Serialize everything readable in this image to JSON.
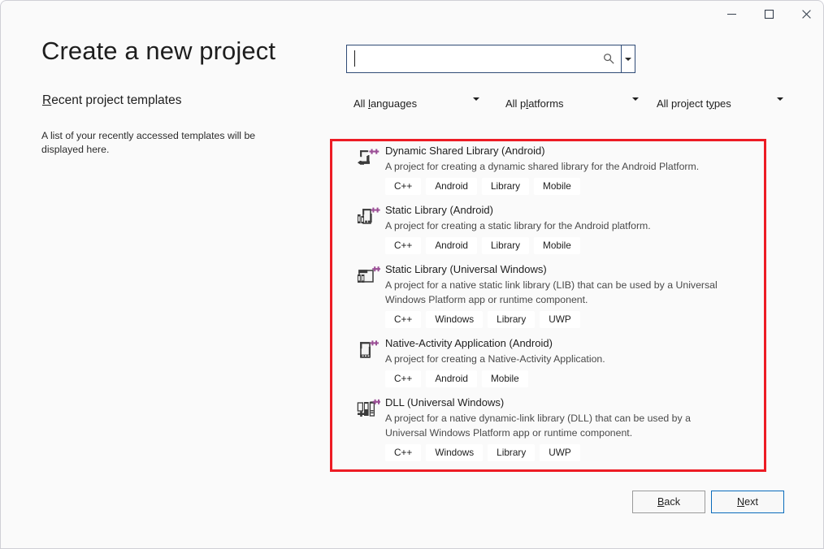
{
  "window": {
    "titlebar": {
      "minimize_label": "Minimize",
      "maximize_label": "Maximize",
      "close_label": "Close"
    }
  },
  "page": {
    "title": "Create a new project"
  },
  "left_panel": {
    "heading_mnemonic": "R",
    "heading_rest": "ecent project templates",
    "description": "A list of your recently accessed templates will be displayed here."
  },
  "search": {
    "value": "",
    "placeholder": "",
    "icon": "search-icon",
    "dropdown_icon": "chevron-down-icon"
  },
  "filters": [
    {
      "mnemonic_pre": "All ",
      "mnemonic": "l",
      "mnemonic_post": "anguages",
      "label": "All languages"
    },
    {
      "mnemonic_pre": "All p",
      "mnemonic": "l",
      "mnemonic_post": "atforms",
      "label": "All platforms"
    },
    {
      "mnemonic_pre": "All project t",
      "mnemonic": "y",
      "mnemonic_post": "pes",
      "label": "All project types"
    }
  ],
  "templates": [
    {
      "icon": "dynamic-shared-library-android-icon",
      "name": "Dynamic Shared Library (Android)",
      "description": "A project for creating a dynamic shared library for the Android Platform.",
      "tags": [
        "C++",
        "Android",
        "Library",
        "Mobile"
      ]
    },
    {
      "icon": "static-library-android-icon",
      "name": "Static Library (Android)",
      "description": "A project for creating a static library for the Android platform.",
      "tags": [
        "C++",
        "Android",
        "Library",
        "Mobile"
      ]
    },
    {
      "icon": "static-library-uwp-icon",
      "name": "Static Library (Universal Windows)",
      "description": "A project for a native static link library (LIB) that can be used by a Universal Windows Platform app or runtime component.",
      "tags": [
        "C++",
        "Windows",
        "Library",
        "UWP"
      ]
    },
    {
      "icon": "native-activity-application-android-icon",
      "name": "Native-Activity Application (Android)",
      "description": "A project for creating a Native-Activity Application.",
      "tags": [
        "C++",
        "Android",
        "Mobile"
      ]
    },
    {
      "icon": "dll-uwp-icon",
      "name": "DLL (Universal Windows)",
      "description": "A project for a native dynamic-link library (DLL) that can be used by a Universal Windows Platform app or runtime component.",
      "tags": [
        "C++",
        "Windows",
        "Library",
        "UWP"
      ]
    }
  ],
  "footer": {
    "back": {
      "mnemonic_pre": "",
      "mnemonic": "B",
      "mnemonic_post": "ack",
      "label": "Back"
    },
    "next": {
      "mnemonic_pre": "",
      "mnemonic": "N",
      "mnemonic_post": "ext",
      "label": "Next"
    }
  },
  "annotation": {
    "highlight_color": "#ed1c24"
  }
}
